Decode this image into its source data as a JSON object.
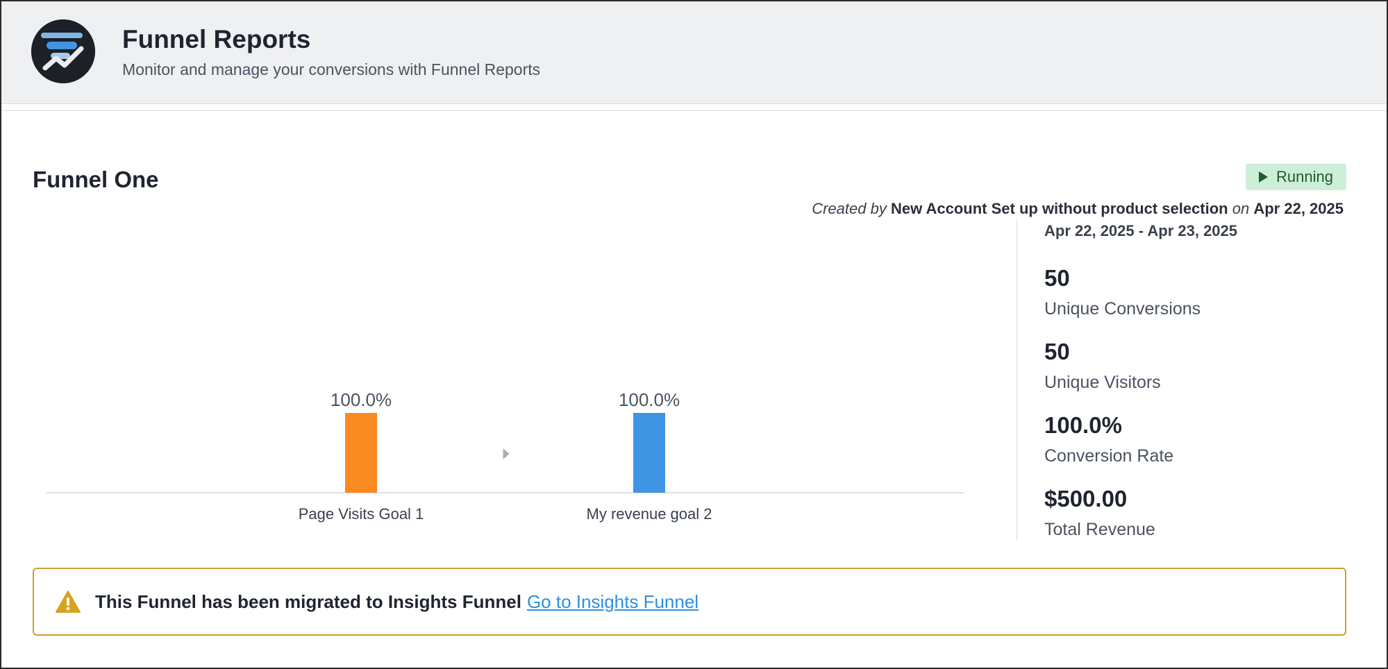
{
  "header": {
    "logo_icon": "funnel-reports-logo-icon",
    "title": "Funnel Reports",
    "subtitle": "Monitor and manage your conversions with Funnel Reports"
  },
  "funnel": {
    "name": "Funnel One",
    "status": {
      "label": "Running",
      "icon": "play-icon",
      "color": "#cdeed7"
    },
    "created": {
      "prefix": "Created by",
      "author": "New Account Set up without product selection",
      "on_word": "on",
      "date": "Apr 22, 2025"
    }
  },
  "stats": {
    "date_range": "Apr 22, 2025 - Apr 23, 2025",
    "items": [
      {
        "value": "50",
        "label": "Unique Conversions"
      },
      {
        "value": "50",
        "label": "Unique Visitors"
      },
      {
        "value": "100.0%",
        "label": "Conversion Rate"
      },
      {
        "value": "$500.00",
        "label": "Total Revenue"
      }
    ]
  },
  "chart_data": {
    "type": "bar",
    "categories": [
      "Page Visits Goal 1",
      "My revenue goal 2"
    ],
    "values": [
      100.0,
      100.0
    ],
    "value_labels": [
      "100.0%",
      "100.0%"
    ],
    "colors": [
      "#f98a22",
      "#3f95e3"
    ],
    "ylim": [
      0,
      100
    ],
    "grid": false
  },
  "alert": {
    "icon": "warning-icon",
    "message": "This Funnel has been migrated to Insights Funnel",
    "link_text": "Go to Insights Funnel",
    "border_color": "#c9a227"
  }
}
